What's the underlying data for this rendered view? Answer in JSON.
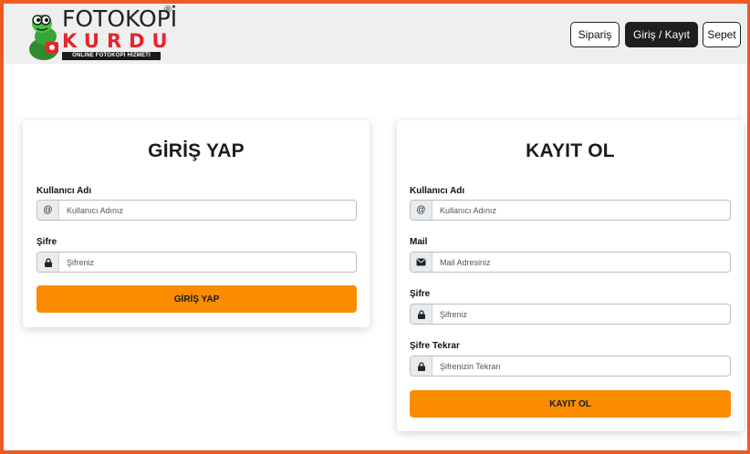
{
  "brand": {
    "line1": "FOTOKOPİ",
    "registered": "®",
    "line2": "KURDU",
    "tagline": "ONLINE FOTOKOPİ HİZMETİ"
  },
  "nav": {
    "orders": "Sipariş",
    "login_register": "Giriş / Kayıt",
    "cart": "Sepet"
  },
  "login": {
    "title": "GİRİŞ YAP",
    "username_label": "Kullanıcı Adı",
    "username_addon": "@",
    "username_placeholder": "Kullanıcı Adınız",
    "password_label": "Şifre",
    "password_placeholder": "Şifreniz",
    "submit": "GİRİŞ YAP"
  },
  "register": {
    "title": "KAYIT OL",
    "username_label": "Kullanıcı Adı",
    "username_addon": "@",
    "username_placeholder": "Kullanıcı Adınız",
    "mail_label": "Mail",
    "mail_placeholder": "Mail Adresiniz",
    "password_label": "Şifre",
    "password_placeholder": "Şifreniz",
    "password_repeat_label": "Şifre Tekrar",
    "password_repeat_placeholder": "Şifrenizin Tekrarı",
    "submit": "KAYIT OL"
  },
  "icons": {
    "lock": "lock-icon",
    "envelope": "envelope-icon",
    "at": "at-icon"
  },
  "colors": {
    "accent": "#fb8c00",
    "frame": "#ef5a24",
    "brand_red": "#e3262b",
    "navbar": "#efefef"
  }
}
